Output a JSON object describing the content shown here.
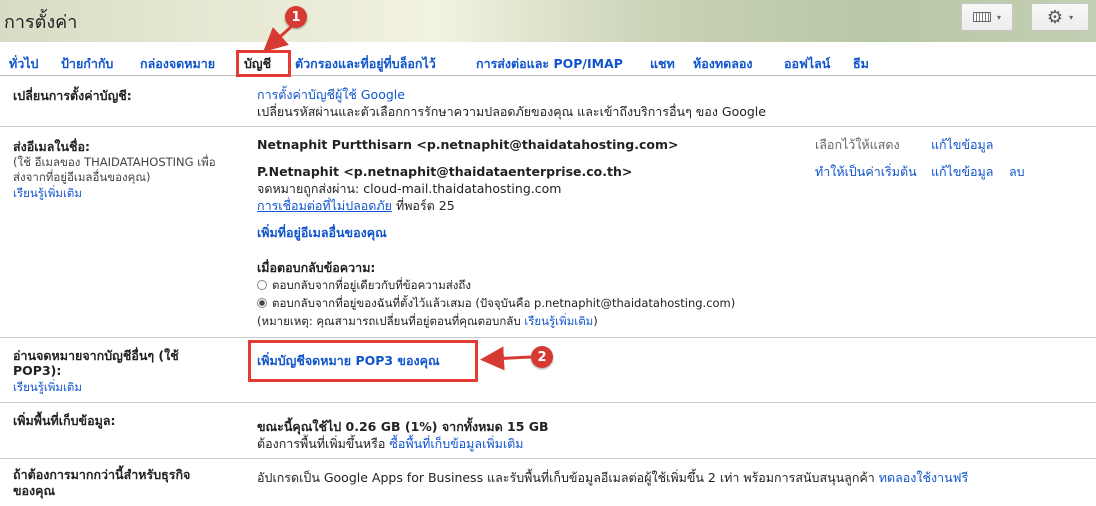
{
  "header": {
    "title": "การตั้งค่า"
  },
  "toolbar": {
    "keyboard_caret": "▾",
    "settings_caret": "▾"
  },
  "tabs": [
    {
      "label": "ทั่วไป"
    },
    {
      "label": "ป้ายกำกับ"
    },
    {
      "label": "กล่องจดหมาย"
    },
    {
      "label": "บัญชี"
    },
    {
      "label": "ตัวกรองและที่อยู่ที่บล็อกไว้"
    },
    {
      "label": "การส่งต่อและ POP/IMAP"
    },
    {
      "label": "แชท"
    },
    {
      "label": "ห้องทดลอง"
    },
    {
      "label": "ออฟไลน์"
    },
    {
      "label": "ธีม"
    }
  ],
  "annotations": {
    "marker1": "1",
    "marker2": "2"
  },
  "change_settings": {
    "label": "เปลี่ยนการตั้งค่าบัญชี:",
    "link": "การตั้งค่าบัญชีผู้ใช้ Google",
    "desc": "เปลี่ยนรหัสผ่านและตัวเลือกการรักษาความปลอดภัยของคุณ และเข้าถึงบริการอื่นๆ ของ Google"
  },
  "send_as": {
    "label": "ส่งอีเมลในชื่อ:",
    "sub1": "(ใช้ อีเมลของ THAIDATAHOSTING เพื่อ",
    "sub2": "ส่งจากที่อยู่อีเมลอื่นของคุณ)",
    "learn_more": "เรียนรู้เพิ่มเติม",
    "address1": "Netnaphit Purtthisarn <p.netnaphit@thaidatahosting.com>",
    "address1_status": "เลือกไว้ให้แสดง",
    "address1_edit": "แก้ไขข้อมูล",
    "address2": "P.Netnaphit <p.netnaphit@thaidataenterprise.co.th>",
    "address2_via": "จดหมายถูกส่งผ่าน: cloud-mail.thaidatahosting.com",
    "address2_insecure": "การเชื่อมต่อที่ไม่ปลอดภัย",
    "address2_port": " ที่พอร์ต 25",
    "address2_default": "ทำให้เป็นค่าเริ่มต้น",
    "address2_edit": "แก้ไขข้อมูล",
    "address2_delete": "ลบ",
    "add_other": "เพิ่มที่อยู่อีเมลอื่นของคุณ",
    "reply_title": "เมื่อตอบกลับข้อความ:",
    "reply_opt1": "ตอบกลับจากที่อยู่เดียวกับที่ข้อความส่งถึง",
    "reply_opt2": "ตอบกลับจากที่อยู่ของฉันที่ตั้งไว้แล้วเสมอ (ปัจจุบันคือ p.netnaphit@thaidatahosting.com)",
    "note": "(หมายเหตุ: คุณสามารถเปลี่ยนที่อยู่ตอนที่คุณตอบกลับ ",
    "note_link": "เรียนรู้เพิ่มเติม",
    "note_end": ")"
  },
  "pop3": {
    "label1": "อ่านจดหมายจากบัญชีอื่นๆ (ใช้",
    "label2": "POP3):",
    "learn_more": "เรียนรู้เพิ่มเติม",
    "add_link": "เพิ่มบัญชีจดหมาย POP3 ของคุณ"
  },
  "storage": {
    "label": "เพิ่มพื้นที่เก็บข้อมูล:",
    "usage": "ขณะนี้คุณใช้ไป 0.26 GB (1%) จากทั้งหมด 15 GB",
    "need_more": "ต้องการพื้นที่เพิ่มขึ้นหรือ ",
    "buy_link": "ซื้อพื้นที่เก็บข้อมูลเพิ่มเติม"
  },
  "business": {
    "label1": "ถ้าต้องการมากกว่านี้สำหรับธุรกิจ",
    "label2": "ของคุณ",
    "desc": "อัปเกรดเป็น Google Apps for Business และรับพื้นที่เก็บข้อมูลอีเมลต่อผู้ใช้เพิ่มขึ้น 2 เท่า พร้อมการสนับสนุนลูกค้า ",
    "trial_link": "ทดลองใช้งานฟรี"
  }
}
